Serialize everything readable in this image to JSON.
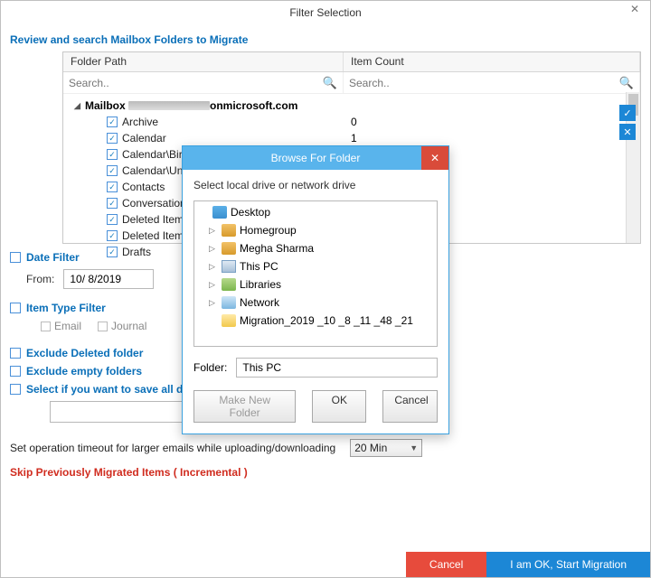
{
  "window": {
    "title": "Filter Selection"
  },
  "sectionTitle": "Review and search Mailbox Folders to Migrate",
  "grid": {
    "headers": {
      "path": "Folder Path",
      "count": "Item Count"
    },
    "searchPlaceholder": "Search..",
    "mailboxPrefix": "Mailbox",
    "mailboxSuffix": "onmicrosoft.com",
    "rows": [
      {
        "label": "Archive",
        "count": "0"
      },
      {
        "label": "Calendar",
        "count": "1"
      },
      {
        "label": "Calendar\\Birthday",
        "count": ""
      },
      {
        "label": "Calendar\\United",
        "count": ""
      },
      {
        "label": "Contacts",
        "count": ""
      },
      {
        "label": "Conversation Hist",
        "count": ""
      },
      {
        "label": "Deleted Items",
        "count": ""
      },
      {
        "label": "Deleted Items\\Ca",
        "count": ""
      },
      {
        "label": "Drafts",
        "count": ""
      }
    ]
  },
  "filters": {
    "dateFilter": "Date Filter",
    "fromLabel": "From:",
    "fromValue": "10/ 8/2019",
    "itemTypeFilter": "Item Type Filter",
    "itemTypes": {
      "email": "Email",
      "journal": "Journal"
    },
    "excludeDeleted": "Exclude Deleted folder",
    "excludeEmpty": "Exclude empty folders",
    "saveAll": "Select if you want to save all dat"
  },
  "timeout": {
    "label": "Set operation timeout for larger emails while uploading/downloading",
    "value": "20 Min"
  },
  "skip": {
    "label": "Skip Previously Migrated Items ( Incremental )"
  },
  "footer": {
    "cancel": "Cancel",
    "start": "I am OK, Start Migration"
  },
  "modal": {
    "title": "Browse For Folder",
    "instruction": "Select local drive or network drive",
    "tree": [
      {
        "label": "Desktop",
        "icon": "ic-desktop",
        "indent": false,
        "exp": ""
      },
      {
        "label": "Homegroup",
        "icon": "ic-home",
        "indent": true,
        "exp": "▷"
      },
      {
        "label": "Megha Sharma",
        "icon": "ic-user",
        "indent": true,
        "exp": "▷"
      },
      {
        "label": "This PC",
        "icon": "ic-pc",
        "indent": true,
        "exp": "▷"
      },
      {
        "label": "Libraries",
        "icon": "ic-lib",
        "indent": true,
        "exp": "▷"
      },
      {
        "label": "Network",
        "icon": "ic-net",
        "indent": true,
        "exp": "▷"
      },
      {
        "label": "Migration_2019 _10 _8 _11 _48 _21",
        "icon": "ic-folder",
        "indent": true,
        "exp": ""
      }
    ],
    "folderLabel": "Folder:",
    "folderValue": "This PC",
    "buttons": {
      "newFolder": "Make New Folder",
      "ok": "OK",
      "cancel": "Cancel"
    }
  }
}
